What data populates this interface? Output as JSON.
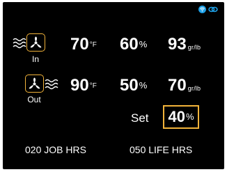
{
  "colors": {
    "background": "#000000",
    "text": "#ffffff",
    "accent": "#f2b33a",
    "status_icon": "#1ea1e8"
  },
  "status_icons": [
    "wifi-icon",
    "link-icon"
  ],
  "inlet": {
    "label": "In",
    "fan_icon": "fan-icon",
    "temperature": "70",
    "temperature_unit": "°F",
    "humidity": "60",
    "humidity_unit": "%",
    "grains": "93",
    "grains_unit": "gr/lb"
  },
  "outlet": {
    "label": "Out",
    "fan_icon": "fan-icon",
    "temperature": "90",
    "temperature_unit": "°F",
    "humidity": "50",
    "humidity_unit": "%",
    "grains": "70",
    "grains_unit": "gr/lb"
  },
  "setpoint": {
    "label": "Set",
    "value": "40",
    "unit": "%"
  },
  "hours": {
    "job_value": "020",
    "job_label": "JOB HRS",
    "life_value": "050",
    "life_label": "LIFE HRS"
  }
}
